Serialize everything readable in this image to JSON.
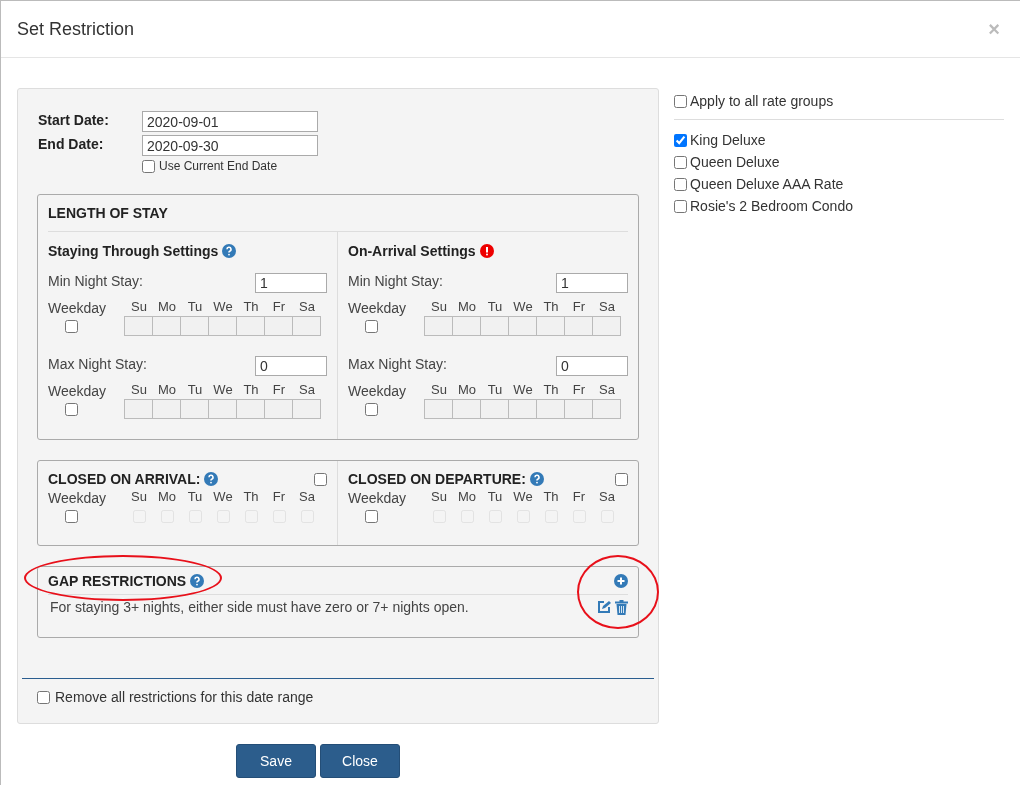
{
  "dialog": {
    "title": "Set Restriction",
    "close": "×"
  },
  "dates": {
    "start_label": "Start Date:",
    "start_value": "2020-09-01",
    "end_label": "End Date:",
    "end_value": "2020-09-30",
    "use_current": {
      "label": "Use Current End Date",
      "checked": false
    }
  },
  "length_of_stay": {
    "title": "LENGTH OF STAY",
    "columns": [
      {
        "title": "Staying Through Settings",
        "kind": "help",
        "rows": [
          {
            "label": "Min Night Stay:",
            "value": "1",
            "weekday_label": "Weekday",
            "weekday_checked": false,
            "days": [
              "Su",
              "Mo",
              "Tu",
              "We",
              "Th",
              "Fr",
              "Sa"
            ]
          },
          {
            "label": "Max Night Stay:",
            "value": "0",
            "weekday_label": "Weekday",
            "weekday_checked": false,
            "days": [
              "Su",
              "Mo",
              "Tu",
              "We",
              "Th",
              "Fr",
              "Sa"
            ]
          }
        ]
      },
      {
        "title": "On-Arrival Settings",
        "kind": "alert",
        "rows": [
          {
            "label": "Min Night Stay:",
            "value": "1",
            "weekday_label": "Weekday",
            "weekday_checked": false,
            "days": [
              "Su",
              "Mo",
              "Tu",
              "We",
              "Th",
              "Fr",
              "Sa"
            ]
          },
          {
            "label": "Max Night Stay:",
            "value": "0",
            "weekday_label": "Weekday",
            "weekday_checked": false,
            "days": [
              "Su",
              "Mo",
              "Tu",
              "We",
              "Th",
              "Fr",
              "Sa"
            ]
          }
        ]
      }
    ]
  },
  "closed": [
    {
      "title": "CLOSED ON ARRIVAL:",
      "checked": false,
      "weekday_label": "Weekday",
      "weekday_checked": false,
      "days": [
        {
          "label": "Su",
          "checked": false
        },
        {
          "label": "Mo",
          "checked": false
        },
        {
          "label": "Tu",
          "checked": false
        },
        {
          "label": "We",
          "checked": false
        },
        {
          "label": "Th",
          "checked": false
        },
        {
          "label": "Fr",
          "checked": false
        },
        {
          "label": "Sa",
          "checked": false
        }
      ]
    },
    {
      "title": "CLOSED ON DEPARTURE:",
      "checked": false,
      "weekday_label": "Weekday",
      "weekday_checked": false,
      "days": [
        {
          "label": "Su",
          "checked": false
        },
        {
          "label": "Mo",
          "checked": false
        },
        {
          "label": "Tu",
          "checked": false
        },
        {
          "label": "We",
          "checked": false
        },
        {
          "label": "Th",
          "checked": false
        },
        {
          "label": "Fr",
          "checked": false
        },
        {
          "label": "Sa",
          "checked": false
        }
      ]
    }
  ],
  "gap_restrictions": {
    "title": "GAP RESTRICTIONS",
    "rules": [
      "For staying 3+ nights, either side must have zero or 7+ nights open."
    ]
  },
  "remove_all": {
    "label": "Remove all restrictions for this date range",
    "checked": false
  },
  "buttons": [
    "Save",
    "Close"
  ],
  "rate_groups": {
    "apply_all": {
      "label": "Apply to all rate groups",
      "checked": false
    },
    "items": [
      {
        "label": "King Deluxe",
        "checked": true
      },
      {
        "label": "Queen Deluxe",
        "checked": false
      },
      {
        "label": "Queen Deluxe AAA Rate",
        "checked": false
      },
      {
        "label": "Rosie's 2 Bedroom Condo",
        "checked": false
      }
    ]
  }
}
